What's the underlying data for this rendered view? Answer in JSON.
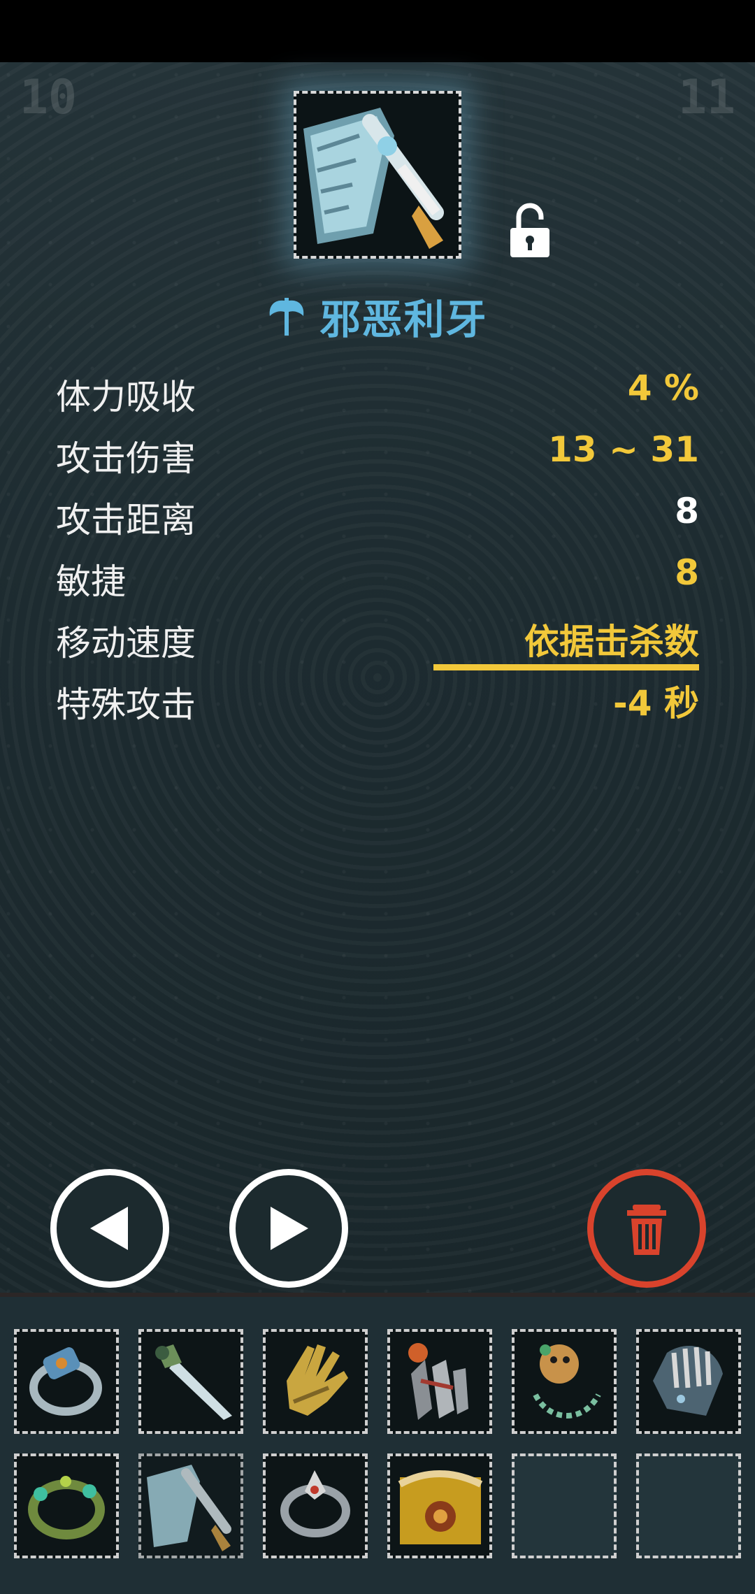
{
  "screen": {
    "corner_left": "10",
    "corner_right": "11"
  },
  "item": {
    "name": "邪恶利牙",
    "icon": "axe-icon",
    "lock_icon": "unlocked-padlock-icon",
    "name_color": "#5fb7e0"
  },
  "stats": [
    {
      "label": "体力吸收",
      "value": "4 %",
      "color": "#f2c83a"
    },
    {
      "label": "攻击伤害",
      "value": "13 ~ 31",
      "color": "#f2c83a"
    },
    {
      "label": "攻击距离",
      "value": "8",
      "color": "#ffffff"
    },
    {
      "label": "敏捷",
      "value": "8",
      "color": "#f2c83a"
    },
    {
      "label": "移动速度",
      "value": "依据击杀数",
      "color": "#f2c83a"
    },
    {
      "label": "特殊攻击",
      "value": "-4 秒",
      "color": "#f2c83a"
    }
  ],
  "controls": {
    "prev_icon": "left-triangle-icon",
    "next_icon": "right-triangle-icon",
    "delete_icon": "trash-icon",
    "delete_color": "#d9432c"
  },
  "inventory": {
    "slots": [
      "ring-icon",
      "dagger-icon",
      "gauntlet-icon",
      "claw-icon",
      "amulet-icon",
      "bracer-icon",
      "bracelet-icon",
      "axe-icon",
      "hook-ring-icon",
      "belt-icon",
      "empty",
      "empty"
    ]
  }
}
